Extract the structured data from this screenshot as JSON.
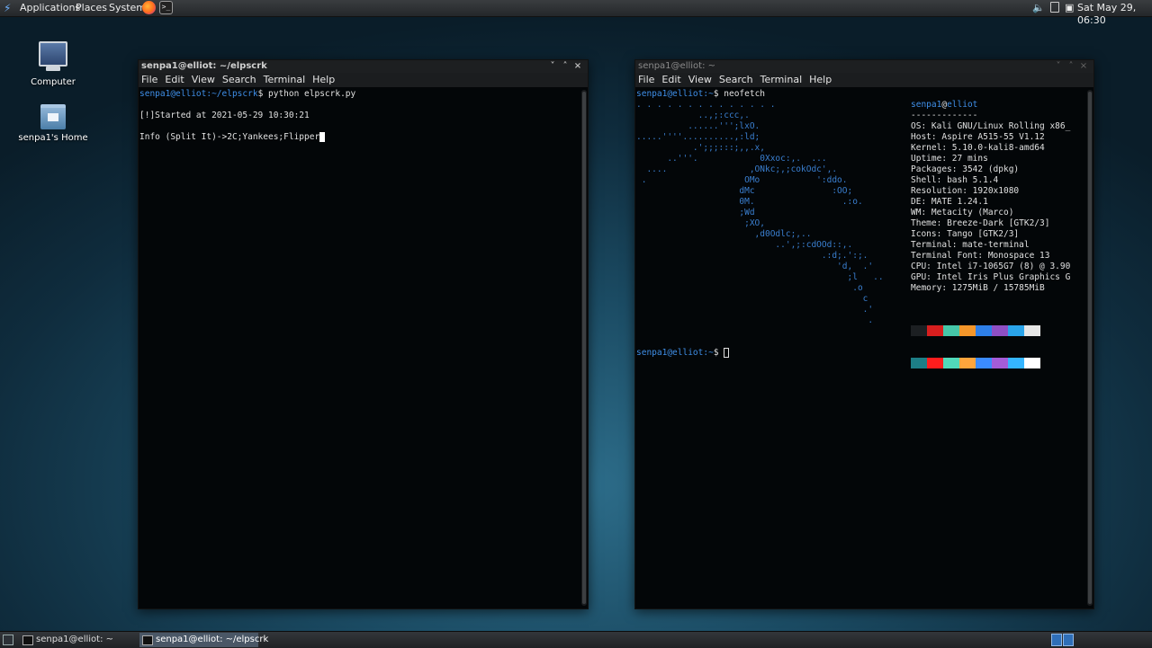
{
  "top_panel": {
    "menus": [
      "Applications",
      "Places",
      "System"
    ],
    "launchers": [
      "firefox-icon",
      "terminal-launcher-icon"
    ],
    "tray": {
      "volume_icon": "speaker-icon",
      "clipboard_icon": "clipboard-icon",
      "clock": "Sat May 29, 06:30"
    }
  },
  "desktop": {
    "icons": [
      {
        "label": "Computer",
        "icon": "computer-icon"
      },
      {
        "label": "senpa1's Home",
        "icon": "home-folder-icon"
      }
    ]
  },
  "window_left": {
    "title": "senpa1@elliot: ~/elpscrk",
    "menu": [
      "File",
      "Edit",
      "View",
      "Search",
      "Terminal",
      "Help"
    ],
    "buttons": [
      "˅",
      "˄",
      "×"
    ],
    "prompt_user": "senpa1@elliot",
    "prompt_path": ":~/elpscrk",
    "prompt_symbol": "$ ",
    "command": "python elpscrk.py",
    "output": [
      "",
      "[!]Started at 2021-05-29 10:30:21",
      "",
      "Info (Split It)->2C;Yankees;Flipper"
    ]
  },
  "window_right": {
    "title": "senpa1@elliot: ~",
    "menu": [
      "File",
      "Edit",
      "View",
      "Search",
      "Terminal",
      "Help"
    ],
    "buttons": [
      "˅",
      "˄",
      "×"
    ],
    "prompt_user": "senpa1@elliot",
    "prompt_path": ":~",
    "prompt_symbol": "$ ",
    "command": "neofetch",
    "ascii_art": ". . . . . . . . . . . . . .\n            ..,;:ccc,.\n          ......''';lxO.\n.....''''..........,:ld;\n           .';;;:::;,,.x,\n      ..'''.            0Xxoc:,.  ...\n  ....                ,ONkc;,;cokOdc',.\n .                   OMo           ':ddo.\n                    dMc               :OO;\n                    0M.                 .:o.\n                    ;Wd\n                     ;XO,\n                       ,d0Odlc;,..\n                           ..',;:cdOOd::,.\n                                    .:d;.':;.\n                                       'd,  .'\n                                         ;l   ..\n                                          .o\n                                            c\n                                            .'\n                                             .",
    "info_header": {
      "user": "senpa1",
      "at": "@",
      "host": "elliot",
      "rule": "-------------"
    },
    "info": [
      {
        "key": "OS",
        "value": "Kali GNU/Linux Rolling x86_"
      },
      {
        "key": "Host",
        "value": "Aspire A515-55 V1.12"
      },
      {
        "key": "Kernel",
        "value": "5.10.0-kali8-amd64"
      },
      {
        "key": "Uptime",
        "value": "27 mins"
      },
      {
        "key": "Packages",
        "value": "3542 (dpkg)"
      },
      {
        "key": "Shell",
        "value": "bash 5.1.4"
      },
      {
        "key": "Resolution",
        "value": "1920x1080"
      },
      {
        "key": "DE",
        "value": "MATE 1.24.1"
      },
      {
        "key": "WM",
        "value": "Metacity (Marco)"
      },
      {
        "key": "Theme",
        "value": "Breeze-Dark [GTK2/3]"
      },
      {
        "key": "Icons",
        "value": "Tango [GTK2/3]"
      },
      {
        "key": "Terminal",
        "value": "mate-terminal"
      },
      {
        "key": "Terminal Font",
        "value": "Monospace 13"
      },
      {
        "key": "CPU",
        "value": "Intel i7-1065G7 (8) @ 3.90"
      },
      {
        "key": "GPU",
        "value": "Intel Iris Plus Graphics G"
      },
      {
        "key": "Memory",
        "value": "1275MiB / 15785MiB"
      }
    ],
    "palette_row1": [
      "#1c1f22",
      "#d81e1e",
      "#46c6a8",
      "#f4962a",
      "#2e7fe8",
      "#8f4fc4",
      "#2aa4ea",
      "#e6e6e6"
    ],
    "palette_row2": [
      "#1d7e86",
      "#ff1d1d",
      "#51d9b9",
      "#ffa53c",
      "#3b8bff",
      "#a45cd8",
      "#35b5ff",
      "#ffffff"
    ]
  },
  "bottom_panel": {
    "tasks": [
      {
        "label": "senpa1@elliot: ~",
        "active": false
      },
      {
        "label": "senpa1@elliot: ~/elpscrk",
        "active": true
      }
    ]
  }
}
